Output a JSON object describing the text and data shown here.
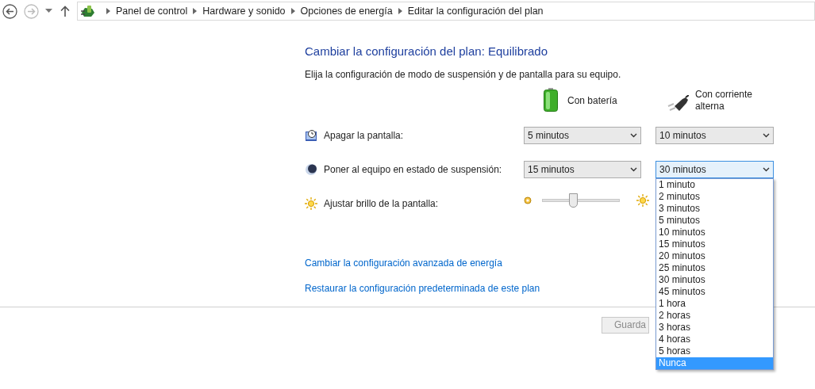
{
  "navigation": {
    "breadcrumb": [
      "Panel de control",
      "Hardware y sonido",
      "Opciones de energía",
      "Editar la configuración del plan"
    ]
  },
  "title": "Cambiar la configuración del plan: Equilibrado",
  "subtitle": "Elija la configuración de modo de suspensión y de pantalla para su equipo.",
  "columns": [
    {
      "kind": "battery",
      "label": "Con batería"
    },
    {
      "kind": "plug",
      "label": "Con corriente alterna"
    }
  ],
  "settings": [
    {
      "kind": "select",
      "label": "Apagar la pantalla:",
      "values": [
        {
          "value": "5 minutos",
          "open": false
        },
        {
          "value": "10 minutos",
          "open": false
        }
      ]
    },
    {
      "kind": "select",
      "label": "Poner al equipo en estado de suspensión:",
      "values": [
        {
          "value": "15 minutos",
          "open": false
        },
        {
          "value": "30 minutos",
          "open": true
        }
      ]
    },
    {
      "kind": "slider",
      "label": "Ajustar brillo de la pantalla:",
      "level": 0.4
    }
  ],
  "dropdown": {
    "options": [
      {
        "label": "1 minuto",
        "selected": false
      },
      {
        "label": "2 minutos",
        "selected": false
      },
      {
        "label": "3 minutos",
        "selected": false
      },
      {
        "label": "5 minutos",
        "selected": false
      },
      {
        "label": "10 minutos",
        "selected": false
      },
      {
        "label": "15 minutos",
        "selected": false
      },
      {
        "label": "20 minutos",
        "selected": false
      },
      {
        "label": "25 minutos",
        "selected": false
      },
      {
        "label": "30 minutos",
        "selected": false
      },
      {
        "label": "45 minutos",
        "selected": false
      },
      {
        "label": "1 hora",
        "selected": false
      },
      {
        "label": "2 horas",
        "selected": false
      },
      {
        "label": "3 horas",
        "selected": false
      },
      {
        "label": "4 horas",
        "selected": false
      },
      {
        "label": "5 horas",
        "selected": false
      },
      {
        "label": "Nunca",
        "selected": true
      }
    ]
  },
  "links": [
    "Cambiar la configuración avanzada de energía",
    "Restaurar la configuración predeterminada de este plan"
  ],
  "buttons": [
    {
      "label": "Guarda"
    }
  ]
}
